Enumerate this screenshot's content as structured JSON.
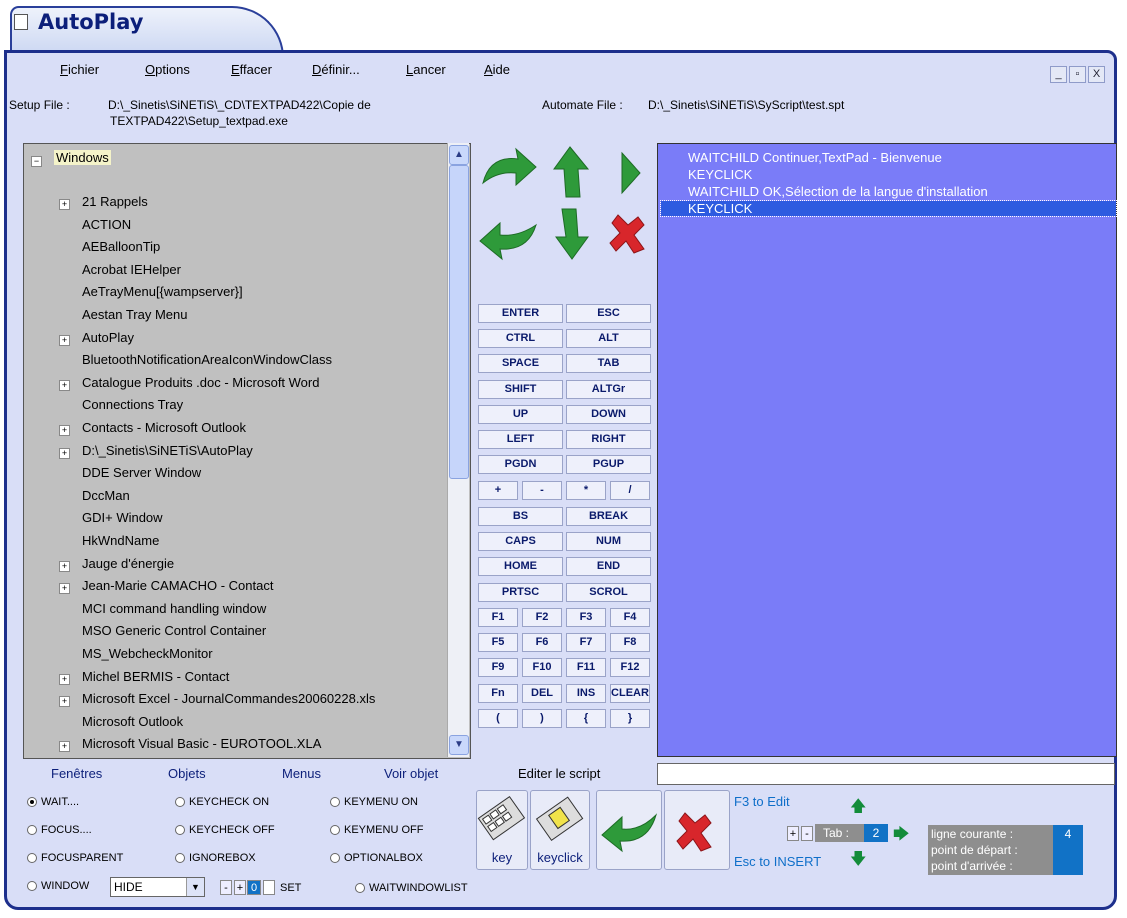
{
  "app": {
    "title": "AutoPlay"
  },
  "menu": [
    "Fichier",
    "Options",
    "Effacer",
    "Définir...",
    "Lancer",
    "Aide"
  ],
  "window_buttons": [
    "_",
    "▫",
    "X"
  ],
  "setup_file": {
    "label": "Setup File :",
    "line1": "D:\\_Sinetis\\SiNETiS\\_CD\\TEXTPAD422\\Copie de",
    "line2": "TEXTPAD422\\Setup_textpad.exe"
  },
  "automate_file": {
    "label": "Automate File :",
    "value": "D:\\_Sinetis\\SiNETiS\\SyScript\\test.spt"
  },
  "tree": {
    "root": "Windows",
    "items": [
      {
        "label": "21 Rappels",
        "expandable": true
      },
      {
        "label": "ACTION",
        "expandable": false
      },
      {
        "label": "AEBalloonTip",
        "expandable": false
      },
      {
        "label": "Acrobat IEHelper",
        "expandable": false
      },
      {
        "label": "AeTrayMenu[{wampserver}]",
        "expandable": false
      },
      {
        "label": "Aestan Tray Menu",
        "expandable": false
      },
      {
        "label": "AutoPlay",
        "expandable": true
      },
      {
        "label": "BluetoothNotificationAreaIconWindowClass",
        "expandable": false
      },
      {
        "label": "Catalogue Produits .doc - Microsoft Word",
        "expandable": true
      },
      {
        "label": "Connections Tray",
        "expandable": false
      },
      {
        "label": "Contacts - Microsoft Outlook",
        "expandable": true
      },
      {
        "label": "D:\\_Sinetis\\SiNETiS\\AutoPlay",
        "expandable": true
      },
      {
        "label": "DDE Server Window",
        "expandable": false
      },
      {
        "label": "DccMan",
        "expandable": false
      },
      {
        "label": "GDI+ Window",
        "expandable": false
      },
      {
        "label": "HkWndName",
        "expandable": false
      },
      {
        "label": "Jauge d'énergie",
        "expandable": true
      },
      {
        "label": "Jean-Marie CAMACHO - Contact",
        "expandable": true
      },
      {
        "label": "MCI command handling window",
        "expandable": false
      },
      {
        "label": "MSO Generic Control Container",
        "expandable": false
      },
      {
        "label": "MS_WebcheckMonitor",
        "expandable": false
      },
      {
        "label": "Michel BERMIS - Contact",
        "expandable": true
      },
      {
        "label": "Microsoft Excel - JournalCommandes20060228.xls",
        "expandable": true
      },
      {
        "label": "Microsoft Outlook",
        "expandable": false
      },
      {
        "label": "Microsoft Visual Basic - EUROTOOL.XLA",
        "expandable": true
      }
    ]
  },
  "keys": {
    "wide": [
      [
        "ENTER",
        "ESC"
      ],
      [
        "CTRL",
        "ALT"
      ],
      [
        "SPACE",
        "TAB"
      ],
      [
        "SHIFT",
        "ALTGr"
      ],
      [
        "UP",
        "DOWN"
      ],
      [
        "LEFT",
        "RIGHT"
      ],
      [
        "PGDN",
        "PGUP"
      ]
    ],
    "ops": [
      "+",
      "-",
      "*",
      "/"
    ],
    "wide2": [
      [
        "BS",
        "BREAK"
      ],
      [
        "CAPS",
        "NUM"
      ],
      [
        "HOME",
        "END"
      ],
      [
        "PRTSC",
        "SCROL"
      ]
    ],
    "small": [
      [
        "F1",
        "F2",
        "F3",
        "F4"
      ],
      [
        "F5",
        "F6",
        "F7",
        "F8"
      ],
      [
        "F9",
        "F10",
        "F11",
        "F12"
      ],
      [
        "Fn",
        "DEL",
        "INS",
        "CLEAR"
      ],
      [
        "(",
        ")",
        "{",
        "}"
      ]
    ]
  },
  "script_lines": [
    {
      "text": "WAITCHILD Continuer,TextPad - Bienvenue",
      "selected": false
    },
    {
      "text": "KEYCLICK",
      "selected": false
    },
    {
      "text": "WAITCHILD OK,Sélection de la langue d'installation",
      "selected": false
    },
    {
      "text": "KEYCLICK",
      "selected": true
    }
  ],
  "bottom_tabs": [
    "Fenêtres",
    "Objets",
    "Menus",
    "Voir objet",
    "Editer le script"
  ],
  "radios": [
    {
      "label": "WAIT....",
      "checked": true
    },
    {
      "label": "FOCUS....",
      "checked": false
    },
    {
      "label": "FOCUSPARENT",
      "checked": false
    },
    {
      "label": "WINDOW",
      "checked": false
    },
    {
      "label": "KEYCHECK ON",
      "checked": false
    },
    {
      "label": "KEYCHECK OFF",
      "checked": false
    },
    {
      "label": "IGNOREBOX",
      "checked": false
    },
    {
      "label": "KEYMENU ON",
      "checked": false
    },
    {
      "label": "KEYMENU OFF",
      "checked": false
    },
    {
      "label": "OPTIONALBOX",
      "checked": false
    },
    {
      "label": "WAITWINDOWLIST",
      "checked": false
    }
  ],
  "window_select": "HIDE",
  "stepper": {
    "minus": "-",
    "plus": "+",
    "value": "0",
    "set_label": "SET"
  },
  "key_buttons": {
    "key": "key",
    "keyclick": "keyclick"
  },
  "hints": {
    "f3": "F3 to Edit",
    "esc": "Esc to INSERT"
  },
  "tab_control": {
    "plus": "+",
    "minus": "-",
    "label": "Tab :",
    "value": "2"
  },
  "status": {
    "current_line_label": "ligne courante :",
    "current_line": "4",
    "start_label": "point de départ :",
    "end_label": "point d'arrivée :"
  },
  "colors": {
    "frame": "#1d2f8c",
    "panel": "#d9def7",
    "script_bg": "#7a7cf8",
    "selected_line": "#2d5be0",
    "arrow_green": "#2e9a3a",
    "arrow_red": "#d8262b"
  }
}
